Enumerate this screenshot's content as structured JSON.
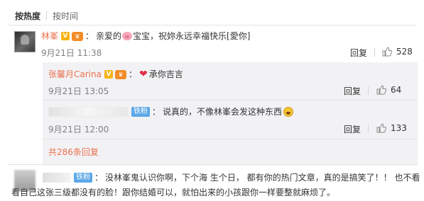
{
  "sort": {
    "hot_label": "按热度",
    "time_label": "按时间"
  },
  "main_comment": {
    "username": "林峯",
    "text_before": "亲爱的",
    "text_after": "宝宝，祝妳永远幸福快乐[愛你]",
    "time": "9月21日 11:38",
    "reply_label": "回复",
    "likes": "528"
  },
  "replies": [
    {
      "username": "张馨月Carina",
      "text": "承你吉言",
      "time": "9月21日 13:05",
      "reply_label": "回复",
      "likes": "64"
    },
    {
      "badge": "铁粉",
      "text": "说真的，不像林峯会发这种东西",
      "time": "9月21日 12:00",
      "reply_label": "回复",
      "likes": "133"
    }
  ],
  "reply_count": "共286条回复",
  "bottom_comment": {
    "badge": "铁粉",
    "text_line1": "没林峯鬼认识你啊，下个海 生个日， 都有你的热门文章，真的是搞笑了！！ 也不看",
    "text_line2": "看自己这张三级都没有的脸！跟你结婚可以，就怕出来的小孩跟你一样要整就麻烦了。"
  },
  "icons": {
    "verified_v": "verified-v-icon",
    "vip": "vip-badge-icon",
    "pig": "pig-emoji-icon",
    "heart": "heart-emoji-icon",
    "laugh": "laugh-emoji-icon",
    "thumb": "thumbs-up-icon"
  },
  "colors": {
    "username": "#eb7350",
    "reply_bg": "#f2f2f5",
    "badge": "#5ca7e8"
  }
}
